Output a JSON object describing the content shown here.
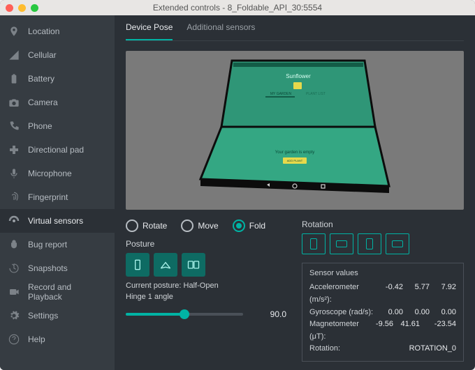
{
  "window": {
    "title": "Extended controls - 8_Foldable_API_30:5554"
  },
  "sidebar": {
    "items": [
      {
        "label": "Location",
        "icon": "location-pin-icon"
      },
      {
        "label": "Cellular",
        "icon": "signal-icon"
      },
      {
        "label": "Battery",
        "icon": "battery-icon"
      },
      {
        "label": "Camera",
        "icon": "camera-icon"
      },
      {
        "label": "Phone",
        "icon": "phone-icon"
      },
      {
        "label": "Directional pad",
        "icon": "dpad-icon"
      },
      {
        "label": "Microphone",
        "icon": "microphone-icon"
      },
      {
        "label": "Fingerprint",
        "icon": "fingerprint-icon"
      },
      {
        "label": "Virtual sensors",
        "icon": "sensors-icon"
      },
      {
        "label": "Bug report",
        "icon": "bug-icon"
      },
      {
        "label": "Snapshots",
        "icon": "history-icon"
      },
      {
        "label": "Record and Playback",
        "icon": "record-icon"
      },
      {
        "label": "Settings",
        "icon": "gear-icon"
      },
      {
        "label": "Help",
        "icon": "help-icon"
      }
    ],
    "active_index": 8
  },
  "tabs": {
    "items": [
      "Device Pose",
      "Additional sensors"
    ],
    "active_index": 0
  },
  "modes": {
    "options": [
      "Rotate",
      "Move",
      "Fold"
    ],
    "selected_index": 2
  },
  "posture": {
    "label": "Posture",
    "current_prefix": "Current posture: ",
    "current_value": "Half-Open",
    "hinge_label": "Hinge 1 angle",
    "hinge_value": "90.0"
  },
  "rotation": {
    "label": "Rotation"
  },
  "sensors": {
    "title": "Sensor values",
    "rows": [
      {
        "label": "Accelerometer (m/s²):",
        "a": "-0.42",
        "b": "5.77",
        "c": "7.92"
      },
      {
        "label": "Gyroscope (rad/s):",
        "a": "0.00",
        "b": "0.00",
        "c": "0.00"
      },
      {
        "label": "Magnetometer (μT):",
        "a": "-9.56",
        "b": "41.61",
        "c": "-23.54"
      }
    ],
    "rotation_label": "Rotation:",
    "rotation_value": "ROTATION_0"
  },
  "preview": {
    "app_title": "Sunflower",
    "tab_a": "MY GARDEN",
    "tab_b": "PLANT LIST",
    "empty_text": "Your garden is empty",
    "cta": "ADD PLANT"
  },
  "colors": {
    "accent": "#00b3a4",
    "device_green": "#34a783"
  }
}
